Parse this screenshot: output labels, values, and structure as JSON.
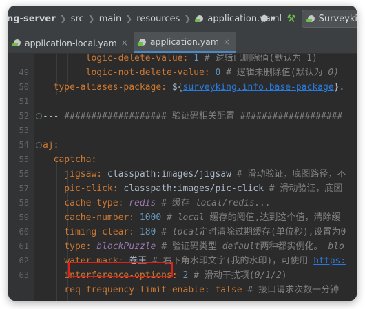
{
  "breadcrumb": {
    "items": [
      "ng-server",
      "src",
      "main",
      "resources",
      "application.yaml"
    ],
    "separator": "❯"
  },
  "toolbar": {
    "user_label": "⬢ ▾",
    "run_config_label": "Surveyki"
  },
  "tabs": [
    {
      "label": "application-local.yam",
      "close": "×",
      "active": false
    },
    {
      "label": "application.yam",
      "close": "×",
      "active": true
    }
  ],
  "lines": [
    {
      "num": "",
      "parts": [
        {
          "t": "        logic-delete-value: ",
          "c": "k"
        },
        {
          "t": "1",
          "c": "n"
        },
        {
          "t": " # 逻辑已删除值(默认为 1)",
          "c": "c"
        }
      ]
    },
    {
      "num": "49",
      "parts": [
        {
          "t": "        logic-not-delete-value: ",
          "c": "k"
        },
        {
          "t": "0",
          "c": "n"
        },
        {
          "t": " # 逻辑未删除值(默认为 ",
          "c": "c"
        },
        {
          "t": "0)",
          "c": "ci"
        }
      ]
    },
    {
      "num": "50",
      "parts": [
        {
          "t": "  type-aliases-package: ",
          "c": "k"
        },
        {
          "t": "${",
          "c": "v"
        },
        {
          "t": "surveyking.info.base-package",
          "c": "lnk"
        },
        {
          "t": "}.",
          "c": "v"
        }
      ]
    },
    {
      "num": "51",
      "parts": []
    },
    {
      "num": "52",
      "parts": [
        {
          "t": "--- ",
          "c": "v"
        },
        {
          "t": "################### 验证码相关配置 ###################",
          "c": "c"
        }
      ]
    },
    {
      "num": "53",
      "parts": []
    },
    {
      "num": "54",
      "parts": [
        {
          "t": "aj:",
          "c": "k"
        }
      ]
    },
    {
      "num": "55",
      "parts": [
        {
          "t": "  captcha:",
          "c": "k"
        }
      ]
    },
    {
      "num": "56",
      "parts": [
        {
          "t": "    jigsaw: ",
          "c": "k"
        },
        {
          "t": "classpath:images/jigsaw",
          "c": "v"
        },
        {
          "t": " # 滑动验证，底图路径，不",
          "c": "c"
        }
      ]
    },
    {
      "num": "57",
      "parts": [
        {
          "t": "    pic-click: ",
          "c": "k"
        },
        {
          "t": "classpath:images/pic-click",
          "c": "v"
        },
        {
          "t": " # 滑动验证，底图",
          "c": "c"
        }
      ]
    },
    {
      "num": "58",
      "parts": [
        {
          "t": "    cache-type: ",
          "c": "k"
        },
        {
          "t": "redis",
          "c": "it"
        },
        {
          "t": " # 缓存 ",
          "c": "c"
        },
        {
          "t": "local/redis...",
          "c": "ci"
        }
      ]
    },
    {
      "num": "59",
      "parts": [
        {
          "t": "    cache-number: ",
          "c": "k"
        },
        {
          "t": "1000",
          "c": "n"
        },
        {
          "t": " # ",
          "c": "c"
        },
        {
          "t": "local",
          "c": "ci"
        },
        {
          "t": " 缓存的阈值,达到这个值，清除缓",
          "c": "c"
        }
      ]
    },
    {
      "num": "60",
      "parts": [
        {
          "t": "    timing-clear: ",
          "c": "k"
        },
        {
          "t": "180",
          "c": "n"
        },
        {
          "t": " # ",
          "c": "c"
        },
        {
          "t": "local",
          "c": "ci"
        },
        {
          "t": "定时清除过期缓存(单位秒),设置为0",
          "c": "c"
        }
      ]
    },
    {
      "num": "61",
      "parts": [
        {
          "t": "    type: ",
          "c": "k"
        },
        {
          "t": "blockPuzzle",
          "c": "it"
        },
        {
          "t": " # 验证码类型 ",
          "c": "c"
        },
        {
          "t": "default",
          "c": "ci"
        },
        {
          "t": "两种都实例化。 ",
          "c": "c"
        },
        {
          "t": "blo",
          "c": "ci"
        }
      ]
    },
    {
      "num": "62",
      "parts": [
        {
          "t": "    water-mark: ",
          "c": "k"
        },
        {
          "t": "卷王",
          "c": "v"
        },
        {
          "t": " # ",
          "c": "c"
        },
        {
          "t": "右下角水印文字(我的水印)，可使用 ",
          "c": "c"
        },
        {
          "t": "https:",
          "c": "lnk"
        }
      ]
    },
    {
      "num": "63",
      "parts": [
        {
          "t": "    interference-options: ",
          "c": "k"
        },
        {
          "t": "2",
          "c": "n"
        },
        {
          "t": " # 滑动干扰项(",
          "c": "c"
        },
        {
          "t": "0/1/2",
          "c": "ci"
        },
        {
          "t": ")",
          "c": "c"
        }
      ]
    },
    {
      "num": "",
      "parts": [
        {
          "t": "    req-frequency-limit-enable: ",
          "c": "k"
        },
        {
          "t": "false",
          "c": "k"
        },
        {
          "t": " # 接口请求次数一分钟",
          "c": "c"
        }
      ]
    }
  ],
  "colors": {
    "keyword": "#cc7832",
    "comment": "#808080",
    "number": "#6897bb",
    "italic_value": "#9876aa",
    "link": "#287bde",
    "highlight": "#e0201a"
  }
}
